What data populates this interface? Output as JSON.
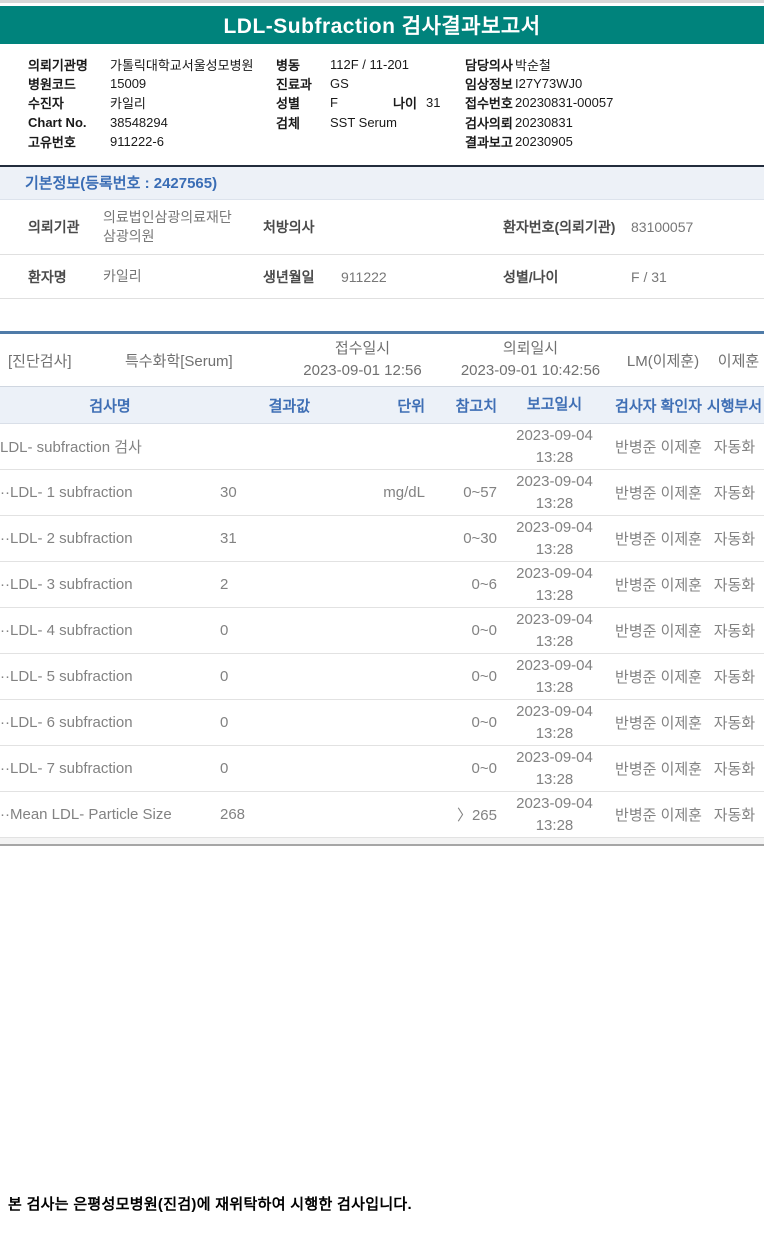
{
  "title": "LDL-Subfraction 검사결과보고서",
  "colors": {
    "teal_brand": "#00837c",
    "accent_blue": "#3a6db5",
    "section_border_blue": "#4f7ba8"
  },
  "header_info": {
    "left": [
      {
        "label": "의뢰기관명",
        "value": "가톨릭대학교서울성모병원"
      },
      {
        "label": "병원코드",
        "value": "15009"
      },
      {
        "label": "수진자",
        "value": "카일리"
      },
      {
        "label": "Chart No.",
        "value": "38548294"
      },
      {
        "label": "고유번호",
        "value": "911222-6"
      }
    ],
    "middle": [
      {
        "label": "병동",
        "value": "112F / 11-201"
      },
      {
        "label": "진료과",
        "value": "GS"
      },
      {
        "label": "성별",
        "value": "F"
      },
      {
        "label": "검체",
        "value": "SST Serum"
      }
    ],
    "age_label": "나이",
    "age_value": "31",
    "right": [
      {
        "label": "담당의사",
        "value": "박순철"
      },
      {
        "label": "임상정보",
        "value": "I27Y73WJ0"
      },
      {
        "label": "접수번호",
        "value": "20230831-00057"
      },
      {
        "label": "검사의뢰",
        "value": "20230831"
      },
      {
        "label": "결과보고",
        "value": "20230905"
      }
    ]
  },
  "basic_info": {
    "section_title": "기본정보(등록번호 : 2427565)",
    "row1": {
      "l1": "의뢰기관",
      "v1": "의료법인삼광의료재단삼광의원",
      "l2": "처방의사",
      "v2": "",
      "l3": "환자번호(의뢰기관)",
      "v3": "83100057"
    },
    "row2": {
      "l1": "환자명",
      "v1": "카일리",
      "l2": "생년월일",
      "v2": "911222",
      "l3": "성별/나이",
      "v3": "F / 31"
    }
  },
  "order": {
    "category": "[진단검사]",
    "test_group": "특수화학[Serum]",
    "receipt_label": "접수일시",
    "receipt_datetime": "2023-09-01 12:56",
    "request_label": "의뢰일시",
    "request_datetime": "2023-09-01 10:42:56",
    "lab": "LM(이제훈)",
    "confirmer": "이제훈"
  },
  "results": {
    "columns": [
      "검사명",
      "결과값",
      "단위",
      "참고치",
      "보고일시",
      "검사자 확인자",
      "시행부서"
    ],
    "rows": [
      {
        "name": "LDL- subfraction 검사",
        "result": "",
        "unit": "",
        "ref": "",
        "reported": "2023-09-04 13:28",
        "staff": "반병준 이제훈",
        "dept": "자동화"
      },
      {
        "name": "··LDL- 1 subfraction",
        "result": "30",
        "unit": "mg/dL",
        "ref": "0~57",
        "reported": "2023-09-04 13:28",
        "staff": "반병준 이제훈",
        "dept": "자동화"
      },
      {
        "name": "··LDL- 2 subfraction",
        "result": "31",
        "unit": "",
        "ref": "0~30",
        "reported": "2023-09-04 13:28",
        "staff": "반병준 이제훈",
        "dept": "자동화"
      },
      {
        "name": "··LDL- 3 subfraction",
        "result": "2",
        "unit": "",
        "ref": "0~6",
        "reported": "2023-09-04 13:28",
        "staff": "반병준 이제훈",
        "dept": "자동화"
      },
      {
        "name": "··LDL- 4 subfraction",
        "result": "0",
        "unit": "",
        "ref": "0~0",
        "reported": "2023-09-04 13:28",
        "staff": "반병준 이제훈",
        "dept": "자동화"
      },
      {
        "name": "··LDL- 5 subfraction",
        "result": "0",
        "unit": "",
        "ref": "0~0",
        "reported": "2023-09-04 13:28",
        "staff": "반병준 이제훈",
        "dept": "자동화"
      },
      {
        "name": "··LDL- 6 subfraction",
        "result": "0",
        "unit": "",
        "ref": "0~0",
        "reported": "2023-09-04 13:28",
        "staff": "반병준 이제훈",
        "dept": "자동화"
      },
      {
        "name": "··LDL- 7 subfraction",
        "result": "0",
        "unit": "",
        "ref": "0~0",
        "reported": "2023-09-04 13:28",
        "staff": "반병준 이제훈",
        "dept": "자동화"
      },
      {
        "name": "··Mean LDL- Particle Size",
        "result": "268",
        "unit": "",
        "ref": "〉265",
        "reported": "2023-09-04 13:28",
        "staff": "반병준 이제훈",
        "dept": "자동화"
      }
    ]
  },
  "footer": {
    "note": "본 검사는 은평성모병원(진검)에 재위탁하여 시행한 검사입니다."
  }
}
